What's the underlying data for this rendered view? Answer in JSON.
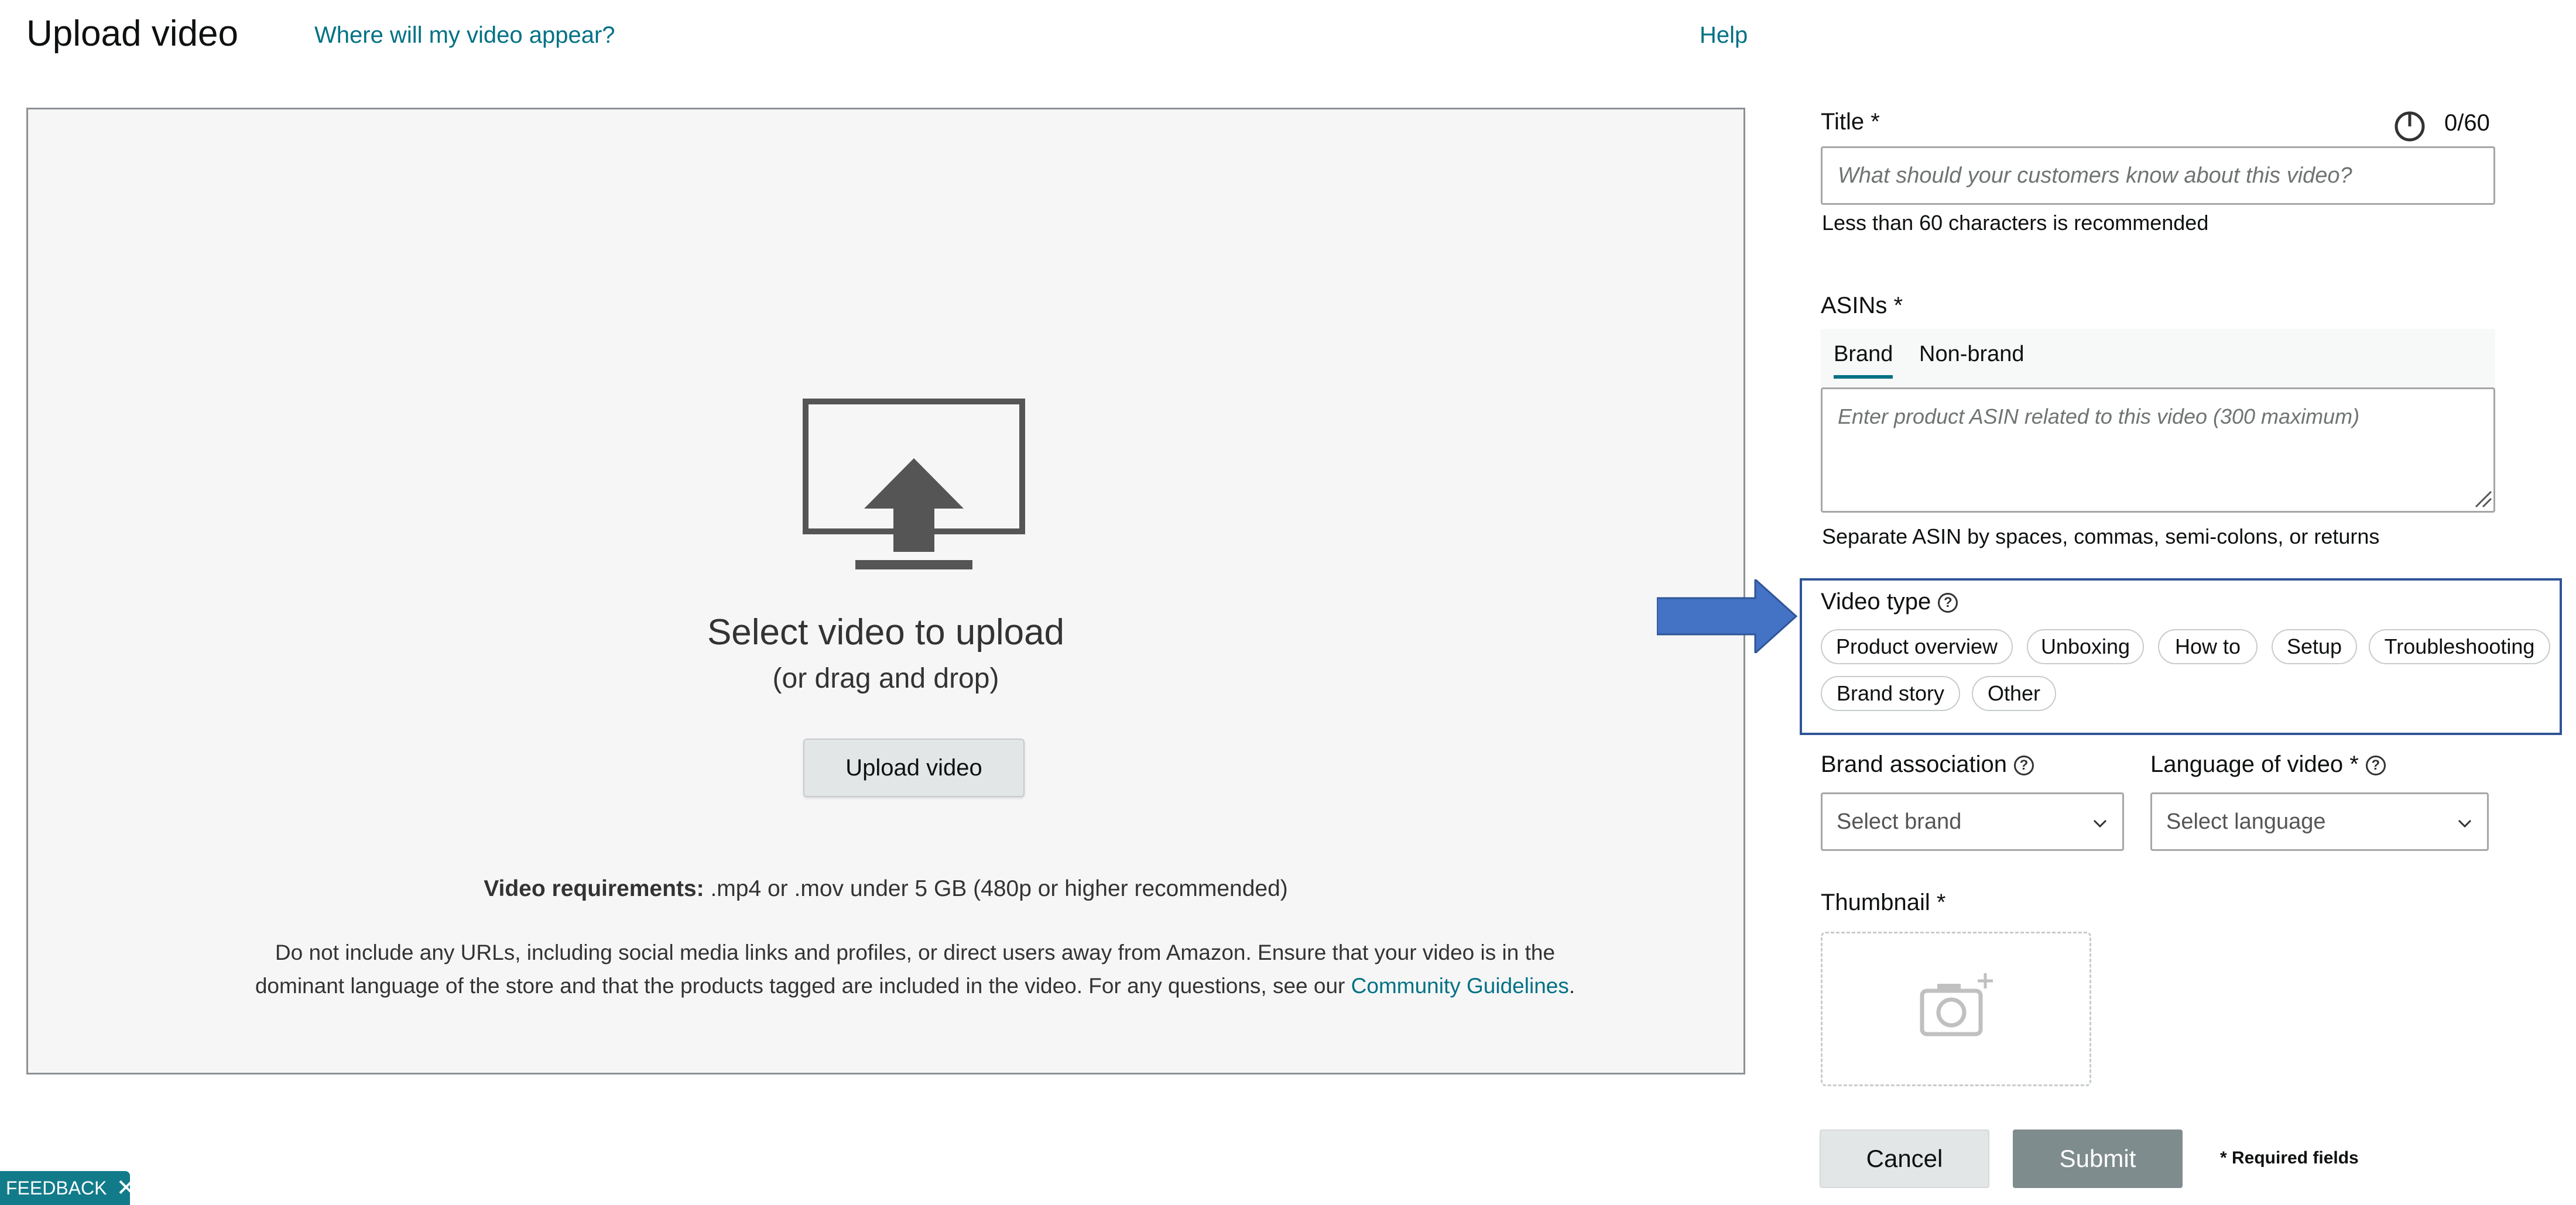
{
  "header": {
    "title": "Upload video",
    "where_link": "Where will my video appear?",
    "help_link": "Help"
  },
  "dropzone": {
    "select_text": "Select video to upload",
    "drag_text": "(or drag and drop)",
    "upload_button": "Upload video",
    "requirements_label": "Video requirements:",
    "requirements_value": " .mp4 or .mov under 5 GB (480p or higher recommended)",
    "policy_text": "Do not include any URLs, including social media links and profiles, or direct users away from Amazon. Ensure that your video is in the dominant language of the store and that the products tagged are included in the video. For any questions, see our ",
    "policy_link": "Community Guidelines",
    "policy_end": "."
  },
  "form": {
    "title_label": "Title *",
    "title_count": "0/60",
    "title_placeholder": "What should your customers know about this video?",
    "title_hint": "Less than 60 characters is recommended",
    "asins_label": "ASINs *",
    "asin_tabs": [
      "Brand",
      "Non-brand"
    ],
    "asin_active_tab": "Brand",
    "asin_placeholder": "Enter product ASIN related to this video (300 maximum)",
    "asin_hint": "Separate ASIN by spaces, commas, semi-colons, or returns",
    "video_type_label": "Video type",
    "video_types": [
      "Product overview",
      "Unboxing",
      "How to",
      "Setup",
      "Troubleshooting",
      "Brand story",
      "Other"
    ],
    "brand_label": "Brand association",
    "brand_placeholder": "Select brand",
    "language_label": "Language of video *",
    "language_placeholder": "Select language",
    "thumbnail_label": "Thumbnail *"
  },
  "actions": {
    "cancel": "Cancel",
    "submit": "Submit",
    "required_note": "* Required fields"
  },
  "feedback": {
    "label": "FEEDBACK",
    "close": "✕"
  },
  "colors": {
    "link": "#007185",
    "highlight": "#2f5597",
    "arrow": "#4472c4",
    "submit_disabled": "#7f8c8d",
    "feedback": "#127b8a"
  }
}
